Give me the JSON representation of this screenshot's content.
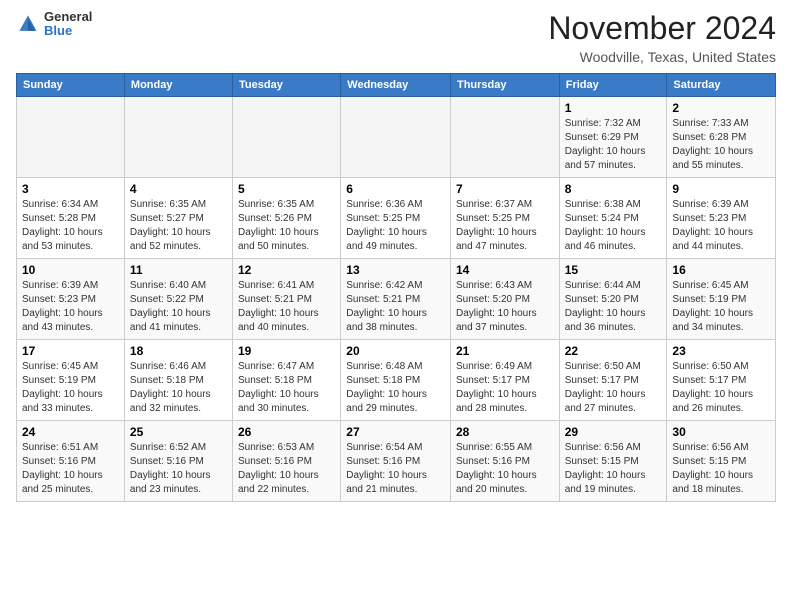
{
  "header": {
    "logo_general": "General",
    "logo_blue": "Blue",
    "month_title": "November 2024",
    "location": "Woodville, Texas, United States"
  },
  "weekdays": [
    "Sunday",
    "Monday",
    "Tuesday",
    "Wednesday",
    "Thursday",
    "Friday",
    "Saturday"
  ],
  "weeks": [
    [
      {
        "day": "",
        "info": ""
      },
      {
        "day": "",
        "info": ""
      },
      {
        "day": "",
        "info": ""
      },
      {
        "day": "",
        "info": ""
      },
      {
        "day": "",
        "info": ""
      },
      {
        "day": "1",
        "info": "Sunrise: 7:32 AM\nSunset: 6:29 PM\nDaylight: 10 hours and 57 minutes."
      },
      {
        "day": "2",
        "info": "Sunrise: 7:33 AM\nSunset: 6:28 PM\nDaylight: 10 hours and 55 minutes."
      }
    ],
    [
      {
        "day": "3",
        "info": "Sunrise: 6:34 AM\nSunset: 5:28 PM\nDaylight: 10 hours and 53 minutes."
      },
      {
        "day": "4",
        "info": "Sunrise: 6:35 AM\nSunset: 5:27 PM\nDaylight: 10 hours and 52 minutes."
      },
      {
        "day": "5",
        "info": "Sunrise: 6:35 AM\nSunset: 5:26 PM\nDaylight: 10 hours and 50 minutes."
      },
      {
        "day": "6",
        "info": "Sunrise: 6:36 AM\nSunset: 5:25 PM\nDaylight: 10 hours and 49 minutes."
      },
      {
        "day": "7",
        "info": "Sunrise: 6:37 AM\nSunset: 5:25 PM\nDaylight: 10 hours and 47 minutes."
      },
      {
        "day": "8",
        "info": "Sunrise: 6:38 AM\nSunset: 5:24 PM\nDaylight: 10 hours and 46 minutes."
      },
      {
        "day": "9",
        "info": "Sunrise: 6:39 AM\nSunset: 5:23 PM\nDaylight: 10 hours and 44 minutes."
      }
    ],
    [
      {
        "day": "10",
        "info": "Sunrise: 6:39 AM\nSunset: 5:23 PM\nDaylight: 10 hours and 43 minutes."
      },
      {
        "day": "11",
        "info": "Sunrise: 6:40 AM\nSunset: 5:22 PM\nDaylight: 10 hours and 41 minutes."
      },
      {
        "day": "12",
        "info": "Sunrise: 6:41 AM\nSunset: 5:21 PM\nDaylight: 10 hours and 40 minutes."
      },
      {
        "day": "13",
        "info": "Sunrise: 6:42 AM\nSunset: 5:21 PM\nDaylight: 10 hours and 38 minutes."
      },
      {
        "day": "14",
        "info": "Sunrise: 6:43 AM\nSunset: 5:20 PM\nDaylight: 10 hours and 37 minutes."
      },
      {
        "day": "15",
        "info": "Sunrise: 6:44 AM\nSunset: 5:20 PM\nDaylight: 10 hours and 36 minutes."
      },
      {
        "day": "16",
        "info": "Sunrise: 6:45 AM\nSunset: 5:19 PM\nDaylight: 10 hours and 34 minutes."
      }
    ],
    [
      {
        "day": "17",
        "info": "Sunrise: 6:45 AM\nSunset: 5:19 PM\nDaylight: 10 hours and 33 minutes."
      },
      {
        "day": "18",
        "info": "Sunrise: 6:46 AM\nSunset: 5:18 PM\nDaylight: 10 hours and 32 minutes."
      },
      {
        "day": "19",
        "info": "Sunrise: 6:47 AM\nSunset: 5:18 PM\nDaylight: 10 hours and 30 minutes."
      },
      {
        "day": "20",
        "info": "Sunrise: 6:48 AM\nSunset: 5:18 PM\nDaylight: 10 hours and 29 minutes."
      },
      {
        "day": "21",
        "info": "Sunrise: 6:49 AM\nSunset: 5:17 PM\nDaylight: 10 hours and 28 minutes."
      },
      {
        "day": "22",
        "info": "Sunrise: 6:50 AM\nSunset: 5:17 PM\nDaylight: 10 hours and 27 minutes."
      },
      {
        "day": "23",
        "info": "Sunrise: 6:50 AM\nSunset: 5:17 PM\nDaylight: 10 hours and 26 minutes."
      }
    ],
    [
      {
        "day": "24",
        "info": "Sunrise: 6:51 AM\nSunset: 5:16 PM\nDaylight: 10 hours and 25 minutes."
      },
      {
        "day": "25",
        "info": "Sunrise: 6:52 AM\nSunset: 5:16 PM\nDaylight: 10 hours and 23 minutes."
      },
      {
        "day": "26",
        "info": "Sunrise: 6:53 AM\nSunset: 5:16 PM\nDaylight: 10 hours and 22 minutes."
      },
      {
        "day": "27",
        "info": "Sunrise: 6:54 AM\nSunset: 5:16 PM\nDaylight: 10 hours and 21 minutes."
      },
      {
        "day": "28",
        "info": "Sunrise: 6:55 AM\nSunset: 5:16 PM\nDaylight: 10 hours and 20 minutes."
      },
      {
        "day": "29",
        "info": "Sunrise: 6:56 AM\nSunset: 5:15 PM\nDaylight: 10 hours and 19 minutes."
      },
      {
        "day": "30",
        "info": "Sunrise: 6:56 AM\nSunset: 5:15 PM\nDaylight: 10 hours and 18 minutes."
      }
    ]
  ]
}
